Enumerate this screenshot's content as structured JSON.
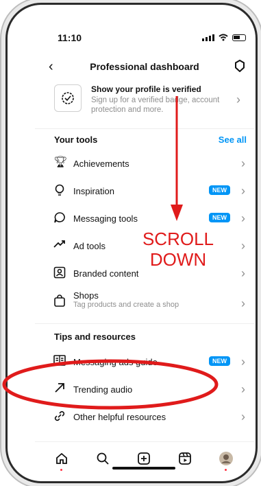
{
  "status": {
    "time": "11:10"
  },
  "nav": {
    "back_icon": "chevron-left-icon",
    "title": "Professional dashboard",
    "settings_icon": "gear-icon"
  },
  "verify": {
    "title": "Show your profile is verified",
    "subtitle": "Sign up for a verified badge, account protection and more.",
    "icon": "verified-badge-icon"
  },
  "tools": {
    "header": "Your tools",
    "see_all": "See all",
    "items": [
      {
        "label": "Achievements",
        "icon": "trophy-icon"
      },
      {
        "label": "Inspiration",
        "icon": "lightbulb-icon",
        "badge": "NEW"
      },
      {
        "label": "Messaging tools",
        "icon": "chat-bubble-icon",
        "badge": "NEW"
      },
      {
        "label": "Ad tools",
        "icon": "trend-arrow-icon"
      },
      {
        "label": "Branded content",
        "icon": "branded-content-icon"
      },
      {
        "label": "Shops",
        "sub": "Tag products and create a shop",
        "icon": "shopping-bag-icon"
      }
    ]
  },
  "tips": {
    "header": "Tips and resources",
    "items": [
      {
        "label": "Messaging ads guide",
        "icon": "book-icon",
        "badge": "NEW"
      },
      {
        "label": "Trending audio",
        "icon": "arrow-up-right-icon"
      },
      {
        "label": "Other helpful resources",
        "icon": "link-icon"
      }
    ]
  },
  "tabbar": {
    "items": [
      "home-icon",
      "search-icon",
      "create-icon",
      "reels-icon",
      "profile-avatar"
    ]
  },
  "annotation": {
    "text_line1": "SCROLL",
    "text_line2": "DOWN",
    "color": "#e01b1b"
  },
  "colors": {
    "accent": "#0095f6",
    "muted": "#8e8e8e",
    "annotation_red": "#e01b1b"
  }
}
